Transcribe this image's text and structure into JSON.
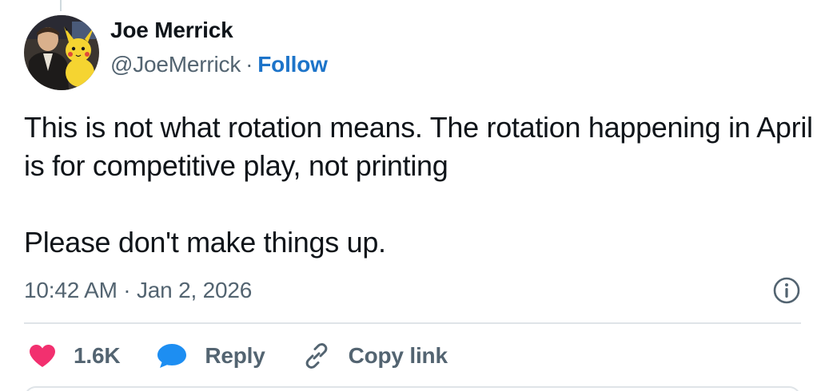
{
  "author": {
    "display_name": "Joe Merrick",
    "handle": "@JoeMerrick",
    "follow_label": "Follow",
    "separator": "·",
    "avatar_icon": "profile-photo-with-yellow-plush"
  },
  "tweet": {
    "line_1": "This is not what rotation means. The rotation happening in April is for competitive play, not printing",
    "line_2": "Please don't make things up."
  },
  "meta": {
    "timestamp": "10:42 AM · Jan 2, 2026",
    "info_icon": "info-icon"
  },
  "actions": {
    "like_count": "1.6K",
    "like_icon": "heart-icon",
    "reply_label": "Reply",
    "reply_icon": "speech-bubble-icon",
    "copy_label": "Copy link",
    "copy_icon": "link-icon"
  },
  "colors": {
    "accent": "#1d74c9",
    "like": "#f2306f",
    "reply": "#1d8ef2",
    "muted_text": "#536471",
    "divider": "#dfe4e8"
  }
}
